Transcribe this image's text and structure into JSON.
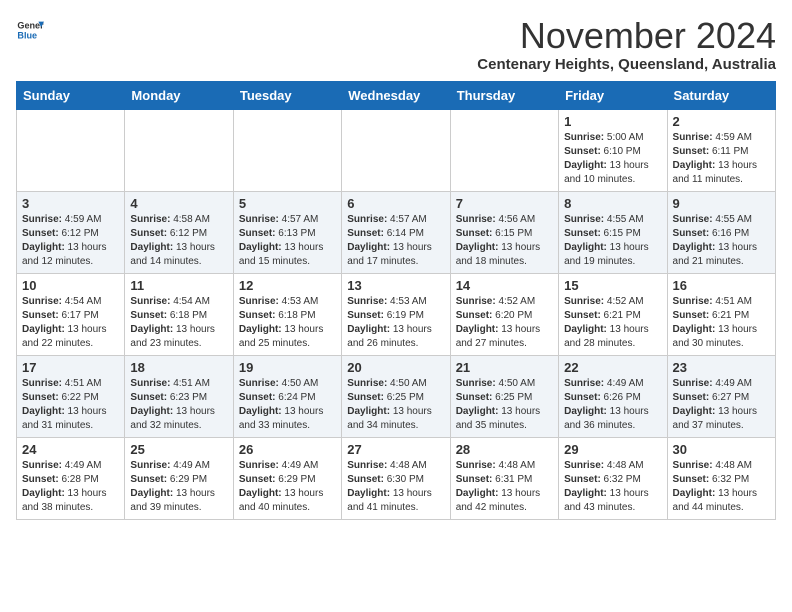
{
  "header": {
    "logo_general": "General",
    "logo_blue": "Blue",
    "month_title": "November 2024",
    "subtitle": "Centenary Heights, Queensland, Australia"
  },
  "calendar": {
    "columns": [
      "Sunday",
      "Monday",
      "Tuesday",
      "Wednesday",
      "Thursday",
      "Friday",
      "Saturday"
    ],
    "weeks": [
      [
        {
          "day": "",
          "info": ""
        },
        {
          "day": "",
          "info": ""
        },
        {
          "day": "",
          "info": ""
        },
        {
          "day": "",
          "info": ""
        },
        {
          "day": "",
          "info": ""
        },
        {
          "day": "1",
          "info": "Sunrise: 5:00 AM\nSunset: 6:10 PM\nDaylight: 13 hours and 10 minutes."
        },
        {
          "day": "2",
          "info": "Sunrise: 4:59 AM\nSunset: 6:11 PM\nDaylight: 13 hours and 11 minutes."
        }
      ],
      [
        {
          "day": "3",
          "info": "Sunrise: 4:59 AM\nSunset: 6:12 PM\nDaylight: 13 hours and 12 minutes."
        },
        {
          "day": "4",
          "info": "Sunrise: 4:58 AM\nSunset: 6:12 PM\nDaylight: 13 hours and 14 minutes."
        },
        {
          "day": "5",
          "info": "Sunrise: 4:57 AM\nSunset: 6:13 PM\nDaylight: 13 hours and 15 minutes."
        },
        {
          "day": "6",
          "info": "Sunrise: 4:57 AM\nSunset: 6:14 PM\nDaylight: 13 hours and 17 minutes."
        },
        {
          "day": "7",
          "info": "Sunrise: 4:56 AM\nSunset: 6:15 PM\nDaylight: 13 hours and 18 minutes."
        },
        {
          "day": "8",
          "info": "Sunrise: 4:55 AM\nSunset: 6:15 PM\nDaylight: 13 hours and 19 minutes."
        },
        {
          "day": "9",
          "info": "Sunrise: 4:55 AM\nSunset: 6:16 PM\nDaylight: 13 hours and 21 minutes."
        }
      ],
      [
        {
          "day": "10",
          "info": "Sunrise: 4:54 AM\nSunset: 6:17 PM\nDaylight: 13 hours and 22 minutes."
        },
        {
          "day": "11",
          "info": "Sunrise: 4:54 AM\nSunset: 6:18 PM\nDaylight: 13 hours and 23 minutes."
        },
        {
          "day": "12",
          "info": "Sunrise: 4:53 AM\nSunset: 6:18 PM\nDaylight: 13 hours and 25 minutes."
        },
        {
          "day": "13",
          "info": "Sunrise: 4:53 AM\nSunset: 6:19 PM\nDaylight: 13 hours and 26 minutes."
        },
        {
          "day": "14",
          "info": "Sunrise: 4:52 AM\nSunset: 6:20 PM\nDaylight: 13 hours and 27 minutes."
        },
        {
          "day": "15",
          "info": "Sunrise: 4:52 AM\nSunset: 6:21 PM\nDaylight: 13 hours and 28 minutes."
        },
        {
          "day": "16",
          "info": "Sunrise: 4:51 AM\nSunset: 6:21 PM\nDaylight: 13 hours and 30 minutes."
        }
      ],
      [
        {
          "day": "17",
          "info": "Sunrise: 4:51 AM\nSunset: 6:22 PM\nDaylight: 13 hours and 31 minutes."
        },
        {
          "day": "18",
          "info": "Sunrise: 4:51 AM\nSunset: 6:23 PM\nDaylight: 13 hours and 32 minutes."
        },
        {
          "day": "19",
          "info": "Sunrise: 4:50 AM\nSunset: 6:24 PM\nDaylight: 13 hours and 33 minutes."
        },
        {
          "day": "20",
          "info": "Sunrise: 4:50 AM\nSunset: 6:25 PM\nDaylight: 13 hours and 34 minutes."
        },
        {
          "day": "21",
          "info": "Sunrise: 4:50 AM\nSunset: 6:25 PM\nDaylight: 13 hours and 35 minutes."
        },
        {
          "day": "22",
          "info": "Sunrise: 4:49 AM\nSunset: 6:26 PM\nDaylight: 13 hours and 36 minutes."
        },
        {
          "day": "23",
          "info": "Sunrise: 4:49 AM\nSunset: 6:27 PM\nDaylight: 13 hours and 37 minutes."
        }
      ],
      [
        {
          "day": "24",
          "info": "Sunrise: 4:49 AM\nSunset: 6:28 PM\nDaylight: 13 hours and 38 minutes."
        },
        {
          "day": "25",
          "info": "Sunrise: 4:49 AM\nSunset: 6:29 PM\nDaylight: 13 hours and 39 minutes."
        },
        {
          "day": "26",
          "info": "Sunrise: 4:49 AM\nSunset: 6:29 PM\nDaylight: 13 hours and 40 minutes."
        },
        {
          "day": "27",
          "info": "Sunrise: 4:48 AM\nSunset: 6:30 PM\nDaylight: 13 hours and 41 minutes."
        },
        {
          "day": "28",
          "info": "Sunrise: 4:48 AM\nSunset: 6:31 PM\nDaylight: 13 hours and 42 minutes."
        },
        {
          "day": "29",
          "info": "Sunrise: 4:48 AM\nSunset: 6:32 PM\nDaylight: 13 hours and 43 minutes."
        },
        {
          "day": "30",
          "info": "Sunrise: 4:48 AM\nSunset: 6:32 PM\nDaylight: 13 hours and 44 minutes."
        }
      ]
    ]
  }
}
